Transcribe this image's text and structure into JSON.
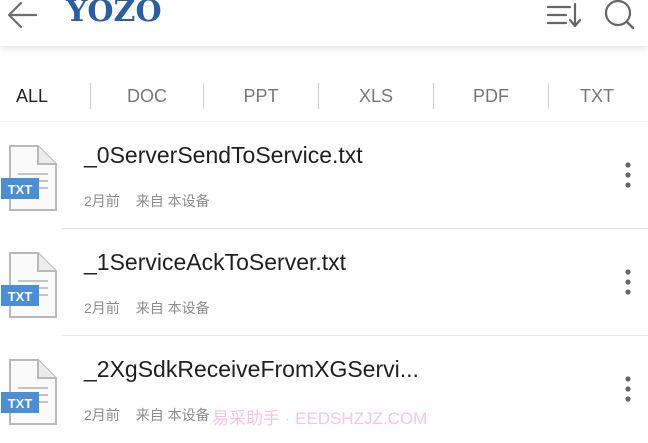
{
  "header": {
    "logo_text": "YOZO",
    "back_icon": "arrow-left-icon",
    "sort_icon": "sort-list-icon",
    "search_icon": "search-icon",
    "logo_color": "#2a5fa5"
  },
  "tabs": [
    {
      "label": "ALL",
      "active": true
    },
    {
      "label": "DOC",
      "active": false
    },
    {
      "label": "PPT",
      "active": false
    },
    {
      "label": "XLS",
      "active": false
    },
    {
      "label": "PDF",
      "active": false
    },
    {
      "label": "TXT",
      "active": false
    }
  ],
  "files": [
    {
      "name": "_0ServerSendToService.txt",
      "time": "2月前",
      "source": "来自 本设备",
      "type_badge": "TXT"
    },
    {
      "name": "_1ServiceAckToServer.txt",
      "time": "2月前",
      "source": "来自 本设备",
      "type_badge": "TXT"
    },
    {
      "name": "_2XgSdkReceiveFromXGServi...",
      "time": "2月前",
      "source": "来自 本设备",
      "type_badge": "TXT"
    }
  ],
  "watermark": "易采助手 · EEDSHZJZ.COM",
  "colors": {
    "txt_badge": "#4a8fd6",
    "divider": "#e6e6e6"
  }
}
